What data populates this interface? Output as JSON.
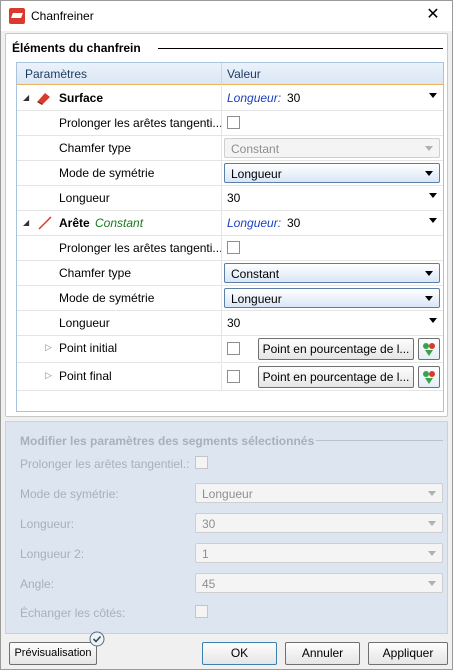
{
  "window": {
    "title": "Chanfreiner"
  },
  "section_elements": {
    "title": "Éléments du chanfrein"
  },
  "grid": {
    "col_params": "Paramètres",
    "col_value": "Valeur",
    "surface": {
      "label": "Surface",
      "value_prefix": "Longueur:",
      "value": "30",
      "extend_label": "Prolonger les arêtes tangenti...",
      "chamfer_type_label": "Chamfer type",
      "chamfer_type_value": "Constant",
      "symmetry_label": "Mode de symétrie",
      "symmetry_value": "Longueur",
      "length_label": "Longueur",
      "length_value": "30"
    },
    "edge": {
      "label": "Arête",
      "tag": "Constant",
      "value_prefix": "Longueur:",
      "value": "30",
      "extend_label": "Prolonger les arêtes tangenti...",
      "chamfer_type_label": "Chamfer type",
      "chamfer_type_value": "Constant",
      "symmetry_label": "Mode de symétrie",
      "symmetry_value": "Longueur",
      "length_label": "Longueur",
      "length_value": "30",
      "start_point_label": "Point initial",
      "start_point_button": "Point en pourcentage de l...",
      "end_point_label": "Point final",
      "end_point_button": "Point en pourcentage de l..."
    }
  },
  "section_segments": {
    "title": "Modifier les paramètres des segments sélectionnés",
    "extend_label": "Prolonger les arêtes tangentiel.:",
    "symmetry_label": "Mode de symétrie:",
    "symmetry_value": "Longueur",
    "length_label": "Longueur:",
    "length_value": "30",
    "length2_label": "Longueur 2:",
    "length2_value": "1",
    "angle_label": "Angle:",
    "angle_value": "45",
    "swap_label": "Échanger les côtés:"
  },
  "footer": {
    "preview": "Prévisualisation",
    "ok": "OK",
    "cancel": "Annuler",
    "apply": "Appliquer"
  }
}
